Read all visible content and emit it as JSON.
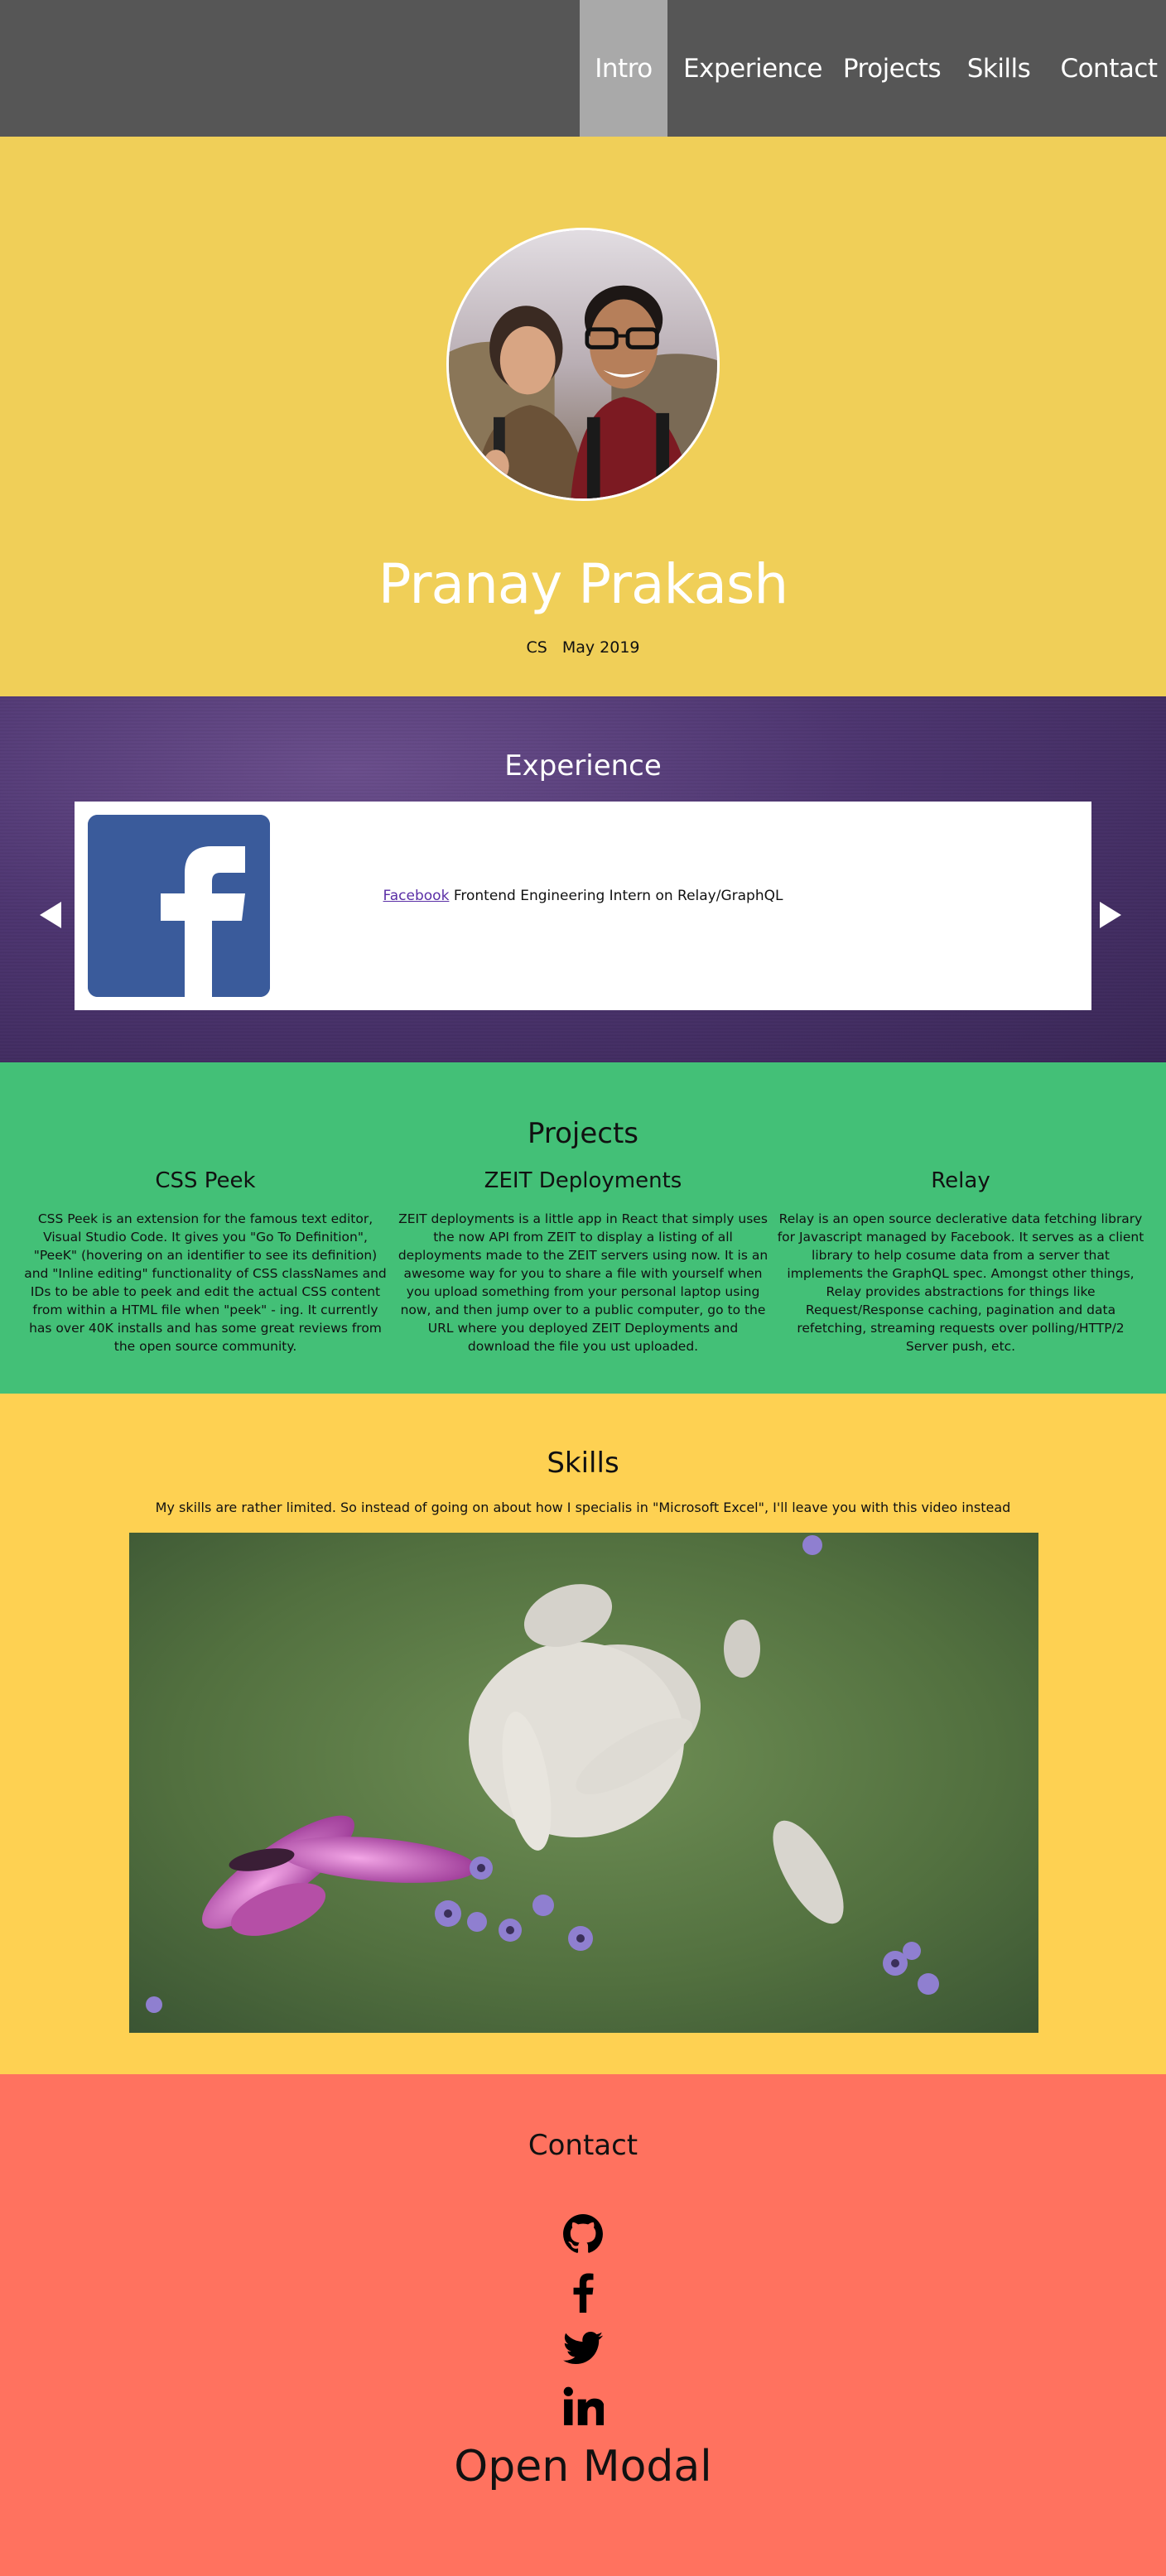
{
  "nav": {
    "items": [
      {
        "label": "Intro",
        "active": true
      },
      {
        "label": "Experience",
        "active": false
      },
      {
        "label": "Projects",
        "active": false
      },
      {
        "label": "Skills",
        "active": false
      },
      {
        "label": "Contact",
        "active": false
      }
    ]
  },
  "intro": {
    "name": "Pranay Prakash",
    "major": "CS",
    "graduation": "May 2019",
    "avatar_icon": "profile-photo"
  },
  "experience": {
    "title": "Experience",
    "company": "Facebook",
    "role": "Frontend Engineering Intern on Relay/GraphQL",
    "logo_icon": "facebook-logo",
    "prev_icon": "arrow-left-icon",
    "next_icon": "arrow-right-icon"
  },
  "projects": {
    "title": "Projects",
    "items": [
      {
        "name": "CSS Peek",
        "description": "CSS Peek is an extension for the famous text editor, Visual Studio Code. It gives you \"Go To Definition\", \"PeeK\" (hovering on an identifier to see its definition) and \"Inline editing\" functionality of CSS classNames and IDs to be able to peek and edit the actual CSS content from within a HTML file when \"peek\" - ing. It currently has over 40K installs and has some great reviews from the open source community."
      },
      {
        "name": "ZEIT Deployments",
        "description": "ZEIT deployments is a little app in React that simply uses the now API from ZEIT to display a listing of all deployments made to the ZEIT servers using now. It is an awesome way for you to share a file with yourself when you upload something from your personal laptop using now, and then jump over to a public computer, go to the URL where you deployed ZEIT Deployments and download the file you ust uploaded."
      },
      {
        "name": "Relay",
        "description": "Relay is an open source declerative data fetching library for Javascript managed by Facebook. It serves as a client library to help cosume data from a server that implements the GraphQL spec. Amongst other things, Relay provides abstractions for things like Request/Response caching, pagination and data refetching, streaming requests over polling/HTTP/2 Server push, etc."
      }
    ]
  },
  "skills": {
    "title": "Skills",
    "description": "My skills are rather limited. So instead of going on about how I specialis in \"Microsoft Excel\", I'll leave you with this video instead",
    "video_icon": "video-player"
  },
  "contact": {
    "title": "Contact",
    "links": [
      "github-icon",
      "facebook-icon",
      "twitter-icon",
      "linkedin-icon"
    ],
    "open_modal": "Open Modal"
  },
  "colors": {
    "nav_bg": "#565656",
    "nav_active": "#a9a9a9",
    "intro_bg": "#f0cf58",
    "projects_bg": "#43c077",
    "skills_bg": "#fed152",
    "contact_bg": "#ff725f"
  }
}
